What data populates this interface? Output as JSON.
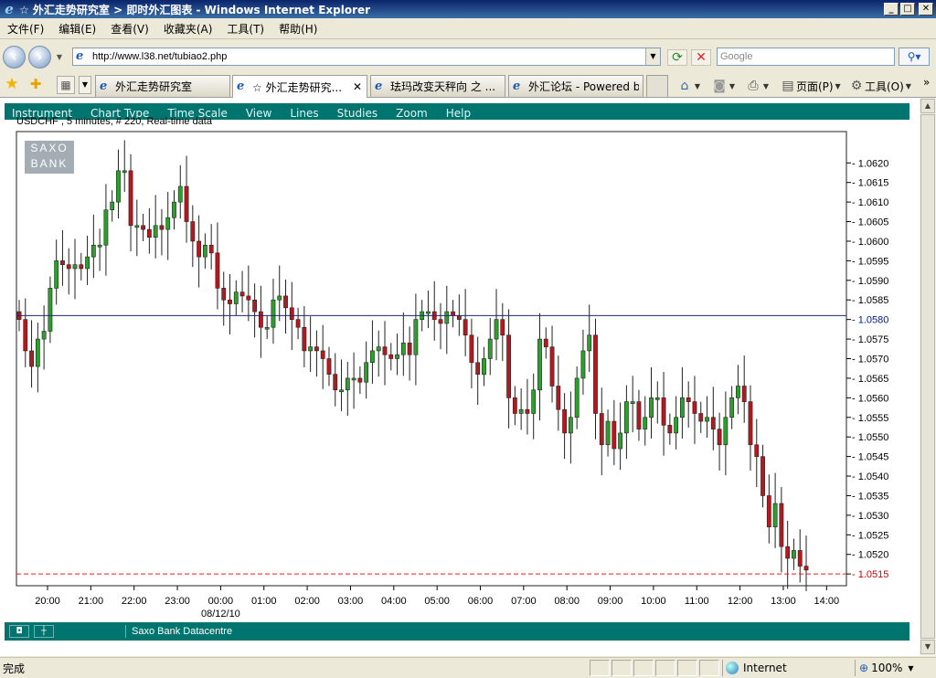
{
  "window": {
    "title": "☆ 外汇走势研究室 > 即时外汇图表 - Windows Internet Explorer",
    "min": "_",
    "max": "□",
    "close": "✕"
  },
  "menu": [
    "文件(F)",
    "编辑(E)",
    "查看(V)",
    "收藏夹(A)",
    "工具(T)",
    "帮助(H)"
  ],
  "address": {
    "url": "http://www.l38.net/tubiao2.php",
    "search_placeholder": "Google"
  },
  "tabs": [
    {
      "label": "外汇走势研究室",
      "active": false
    },
    {
      "label": "☆ 外汇走势研究...",
      "active": true
    },
    {
      "label": "珐玛改变天秤向 之 ...",
      "active": false
    },
    {
      "label": "外汇论坛 - Powered b...",
      "active": false
    }
  ],
  "commands": {
    "page": "页面(P)",
    "tools": "工具(O)"
  },
  "app": {
    "menu": [
      "Instrument",
      "Chart Type",
      "Time Scale",
      "View",
      "Lines",
      "Studies",
      "Zoom",
      "Help"
    ],
    "info": "USDCHF , 5 minutes, # 220, Real-time data",
    "logo_line1": "SAXO",
    "logo_line2": "BANK",
    "footer_text": "Saxo Bank Datacentre"
  },
  "chart_data": {
    "type": "candlestick",
    "instrument": "USDCHF",
    "x_ticks": [
      "20:00",
      "21:00",
      "22:00",
      "23:00",
      "00:00",
      "01:00",
      "02:00",
      "03:00",
      "04:00",
      "05:00",
      "06:00",
      "07:00",
      "08:00",
      "09:00",
      "10:00",
      "11:00",
      "12:00",
      "13:00",
      "14:00"
    ],
    "date_label": "08/12/10",
    "y_ticks": [
      "1.0620",
      "1.0615",
      "1.0610",
      "1.0605",
      "1.0600",
      "1.0595",
      "1.0590",
      "1.0585",
      "1.0580",
      "1.0575",
      "1.0570",
      "1.0565",
      "1.0560",
      "1.0555",
      "1.0550",
      "1.0545",
      "1.0540",
      "1.0535",
      "1.0530",
      "1.0525",
      "1.0520",
      "1.0515"
    ],
    "ylim": [
      1.0512,
      1.0628
    ],
    "reference_line": 1.0581,
    "current_price": 1.0515,
    "current_label": "1.0515",
    "up_color": "#2ca02c",
    "down_color": "#b5181f",
    "closes": [
      1.058,
      1.0572,
      1.0568,
      1.0575,
      1.0577,
      1.0588,
      1.0595,
      1.0594,
      1.0593,
      1.0594,
      1.0593,
      1.0596,
      1.0599,
      1.0599,
      1.0608,
      1.061,
      1.0618,
      1.0618,
      1.0604,
      1.0604,
      1.0603,
      1.0601,
      1.0604,
      1.0603,
      1.0606,
      1.061,
      1.0614,
      1.0605,
      1.06,
      1.0596,
      1.0599,
      1.0597,
      1.0588,
      1.0585,
      1.0584,
      1.0587,
      1.0586,
      1.0585,
      1.0582,
      1.0578,
      1.0578,
      1.0585,
      1.0586,
      1.0583,
      1.058,
      1.0578,
      1.0572,
      1.0573,
      1.0572,
      1.057,
      1.0566,
      1.0562,
      1.0562,
      1.0565,
      1.0565,
      1.0564,
      1.0569,
      1.0572,
      1.0573,
      1.0571,
      1.057,
      1.0571,
      1.0574,
      1.0571,
      1.058,
      1.0582,
      1.0582,
      1.058,
      1.0579,
      1.0582,
      1.0581,
      1.058,
      1.0576,
      1.0569,
      1.0566,
      1.057,
      1.0575,
      1.058,
      1.0576,
      1.056,
      1.0556,
      1.0557,
      1.0556,
      1.0562,
      1.0575,
      1.0573,
      1.0563,
      1.0557,
      1.0551,
      1.0555,
      1.0565,
      1.0572,
      1.0576,
      1.0556,
      1.0548,
      1.0554,
      1.0547,
      1.0551,
      1.0559,
      1.0559,
      1.0552,
      1.0555,
      1.056,
      1.056,
      1.0553,
      1.0551,
      1.0555,
      1.056,
      1.0559,
      1.0556,
      1.0554,
      1.0555,
      1.0552,
      1.0548,
      1.0555,
      1.056,
      1.0563,
      1.0559,
      1.0548,
      1.0545,
      1.0535,
      1.0527,
      1.0533,
      1.0522,
      1.0519,
      1.0521,
      1.0517,
      1.0516
    ]
  },
  "footer_buttons": [
    "◘",
    "┼"
  ],
  "status": {
    "text": "完成",
    "zone": "Internet",
    "zoom": "100%"
  }
}
